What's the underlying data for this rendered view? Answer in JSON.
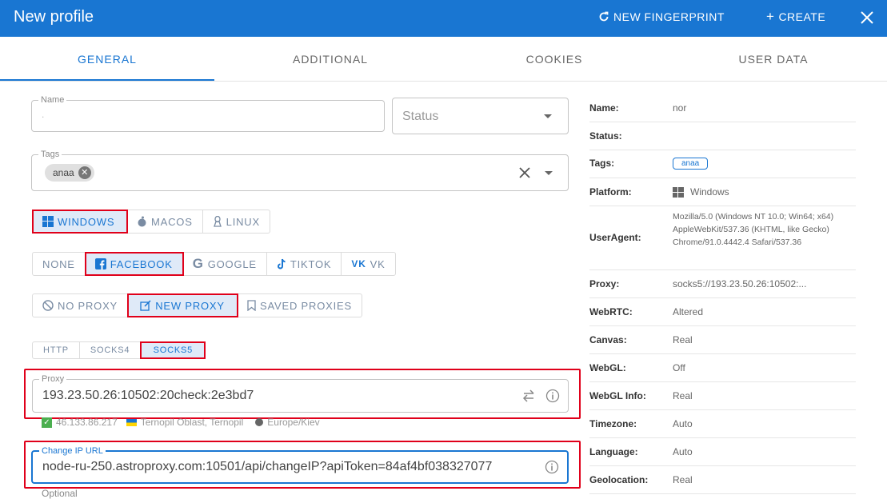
{
  "header": {
    "title": "New profile",
    "new_fingerprint": "NEW FINGERPRINT",
    "create": "CREATE"
  },
  "tabs": [
    {
      "label": "GENERAL",
      "active": true
    },
    {
      "label": "ADDITIONAL",
      "active": false
    },
    {
      "label": "COOKIES",
      "active": false
    },
    {
      "label": "USER DATA",
      "active": false
    }
  ],
  "form": {
    "name": {
      "label": "Name",
      "value": "."
    },
    "status": {
      "placeholder": "Status"
    },
    "tags": {
      "label": "Tags",
      "chips": [
        "anaa"
      ]
    },
    "platform": {
      "options": [
        "WINDOWS",
        "MACOS",
        "LINUX"
      ],
      "selected": "WINDOWS"
    },
    "site": {
      "options": [
        "NONE",
        "FACEBOOK",
        "GOOGLE",
        "TIKTOK",
        "VK"
      ],
      "selected": "FACEBOOK"
    },
    "proxy_mode": {
      "options": [
        "NO PROXY",
        "NEW PROXY",
        "SAVED PROXIES"
      ],
      "selected": "NEW PROXY"
    },
    "proxy_type": {
      "options": [
        "HTTP",
        "SOCKS4",
        "SOCKS5"
      ],
      "selected": "SOCKS5"
    },
    "proxy": {
      "label": "Proxy",
      "value": "193.23.50.26:10502:20check:2e3bd7"
    },
    "proxy_check": {
      "ip": "46.133.86.217",
      "location": "Ternopil Oblast, Ternopil",
      "timezone": "Europe/Kiev"
    },
    "change_ip": {
      "label": "Change IP URL",
      "value": "node-ru-250.astroproxy.com:10501/api/changeIP?apiToken=84af4bf038327077",
      "helper": "Optional"
    }
  },
  "summary": {
    "name": {
      "label": "Name:",
      "value": "nor"
    },
    "status": {
      "label": "Status:",
      "value": ""
    },
    "tags": {
      "label": "Tags:",
      "value": "anaa"
    },
    "platform": {
      "label": "Platform:",
      "value": "Windows"
    },
    "useragent": {
      "label": "UserAgent:",
      "value": "Mozilla/5.0 (Windows NT 10.0; Win64; x64) AppleWebKit/537.36 (KHTML, like Gecko) Chrome/91.0.4442.4 Safari/537.36"
    },
    "proxy": {
      "label": "Proxy:",
      "value": "socks5://193.23.50.26:10502:..."
    },
    "webrtc": {
      "label": "WebRTC:",
      "value": "Altered"
    },
    "canvas": {
      "label": "Canvas:",
      "value": "Real"
    },
    "webgl": {
      "label": "WebGL:",
      "value": "Off"
    },
    "webgl_info": {
      "label": "WebGL Info:",
      "value": "Real"
    },
    "timezone": {
      "label": "Timezone:",
      "value": "Auto"
    },
    "language": {
      "label": "Language:",
      "value": "Auto"
    },
    "geolocation": {
      "label": "Geolocation:",
      "value": "Real"
    }
  },
  "colors": {
    "primary": "#1976d2",
    "highlight": "#e0001a",
    "selected_bg": "#dfeaf8"
  }
}
